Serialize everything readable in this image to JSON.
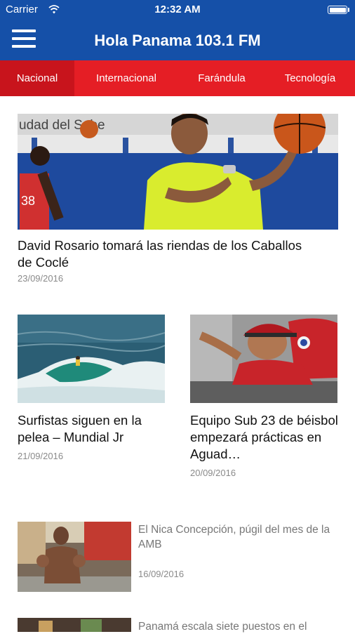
{
  "status_bar": {
    "carrier": "Carrier",
    "time": "12:32 AM",
    "battery_level": 1.0
  },
  "header": {
    "title": "Hola Panama 103.1 FM",
    "menu_icon": "hamburger-menu-icon"
  },
  "tabs": [
    {
      "label": "Nacional",
      "active": true
    },
    {
      "label": "Internacional",
      "active": false
    },
    {
      "label": "Farándula",
      "active": false
    },
    {
      "label": "Tecnología",
      "active": false
    }
  ],
  "featured": {
    "title": "David Rosario tomará las riendas de los Caballos de Coclé",
    "date": "23/09/2016",
    "image_sign_text": "udad del Sabe"
  },
  "grid": [
    {
      "title": "Surfistas siguen en la pelea – Mundial Jr",
      "date": "21/09/2016"
    },
    {
      "title": "Equipo Sub 23 de béisbol empezará prácticas en Aguad…",
      "date": "20/09/2016"
    }
  ],
  "list": [
    {
      "title": "El Nica Concepción, púgil del mes de la AMB",
      "date": "16/09/2016"
    },
    {
      "title": "Panamá escala siete puestos en el"
    }
  ],
  "colors": {
    "header_blue": "#1550a8",
    "tab_red": "#e51e25",
    "tab_active": "#c8141c"
  }
}
